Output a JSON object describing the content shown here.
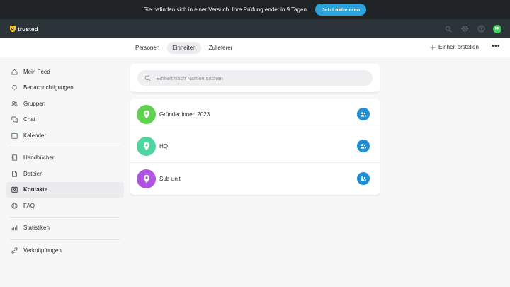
{
  "trial": {
    "message": "Sie befinden sich in einer Versuch. Ihre Prüfung endet in 9 Tagen.",
    "button": "Jetzt aktivieren"
  },
  "header": {
    "logo_text": "trusted",
    "avatar_initials": "FR",
    "avatar_color": "#3ecf5c",
    "icons": [
      "search-icon",
      "gear-icon",
      "help-icon"
    ]
  },
  "subnav": {
    "tabs": [
      {
        "label": "Personen",
        "active": false
      },
      {
        "label": "Einheiten",
        "active": true
      },
      {
        "label": "Zulieferer",
        "active": false
      }
    ],
    "create_label": "Einheit erstellen",
    "more_label": "•••"
  },
  "sidebar": {
    "groups": [
      [
        {
          "label": "Mein Feed",
          "icon": "home-icon"
        },
        {
          "label": "Benachrichtigungen",
          "icon": "bell-icon"
        },
        {
          "label": "Gruppen",
          "icon": "people-icon"
        },
        {
          "label": "Chat",
          "icon": "chat-icon"
        },
        {
          "label": "Kalender",
          "icon": "calendar-icon"
        }
      ],
      [
        {
          "label": "Handbücher",
          "icon": "book-icon"
        },
        {
          "label": "Dateien",
          "icon": "file-icon"
        },
        {
          "label": "Kontakte",
          "icon": "contacts-icon",
          "active": true
        },
        {
          "label": "FAQ",
          "icon": "globe-icon"
        }
      ],
      [
        {
          "label": "Statistiken",
          "icon": "stats-icon"
        }
      ],
      [
        {
          "label": "Verknüpfungen",
          "icon": "link-icon"
        }
      ]
    ]
  },
  "search": {
    "placeholder": "Einheit nach Namen suchen",
    "value": ""
  },
  "units": [
    {
      "name": "Gründer:innen 2023",
      "color": "#5fd34f"
    },
    {
      "name": "HQ",
      "color": "#4fd5a0"
    },
    {
      "name": "Sub-unit",
      "color": "#b054e0"
    }
  ],
  "colors": {
    "accent": "#2aa3dc",
    "member_button": "#1d8fd8"
  }
}
